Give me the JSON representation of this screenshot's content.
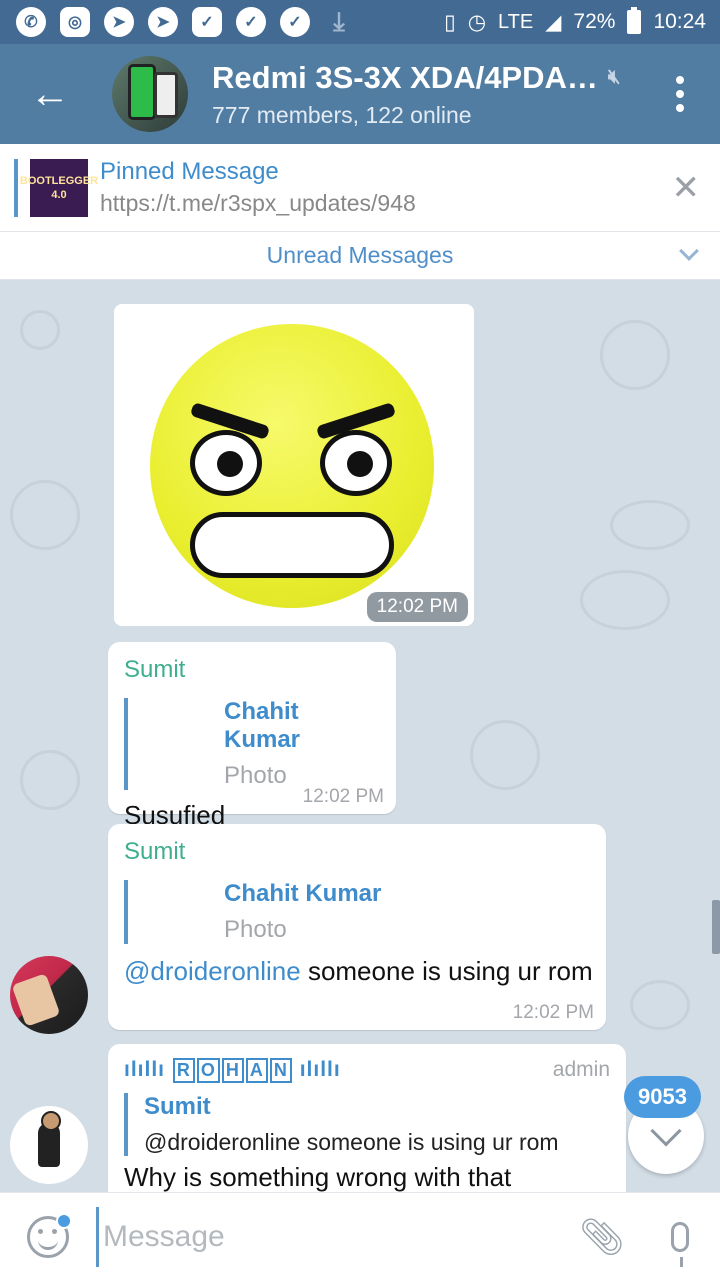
{
  "status_bar": {
    "icons": [
      "whatsapp-icon",
      "instagram-icon",
      "telegram-icon",
      "telegram-icon",
      "feedly-icon",
      "check-icon",
      "check-icon",
      "download-icon"
    ],
    "network": "LTE",
    "battery": "72%",
    "time": "10:24"
  },
  "header": {
    "title": "Redmi 3S-3X XDA/4PDA…",
    "subtitle": "777 members, 122 online"
  },
  "pinned": {
    "title": "Pinned Message",
    "url": "https://t.me/r3spx_updates/948",
    "thumb_text": "BOOTLEGGER",
    "thumb_version": "4.0"
  },
  "unread": {
    "label": "Unread Messages"
  },
  "messages": [
    {
      "type": "sticker",
      "time": "12:02 PM"
    },
    {
      "sender": "Sumit",
      "reply_name": "Chahit Kumar",
      "reply_text": "Photo",
      "text": "Susufied",
      "time": "12:02 PM"
    },
    {
      "sender": "Sumit",
      "reply_name": "Chahit Kumar",
      "reply_text": "Photo",
      "mention": "@droideronline",
      "text": " someone is using ur rom",
      "time": "12:02 PM"
    },
    {
      "sender_prefix": "ılıllı",
      "sender_letters": [
        "R",
        "O",
        "H",
        "A",
        "N"
      ],
      "sender_suffix": "ılıllı",
      "role": "admin",
      "reply_name": "Sumit",
      "reply_text": "@droideronline someone is using ur rom",
      "text": "Why is something wrong with that"
    }
  ],
  "scroll_badge": "9053",
  "input": {
    "placeholder": "Message"
  },
  "colors": {
    "header": "#527da3",
    "status_bar": "#426a92",
    "accent": "#3e8ccc",
    "sender_green": "#3fae8e",
    "chat_bg": "#d3dde6"
  }
}
